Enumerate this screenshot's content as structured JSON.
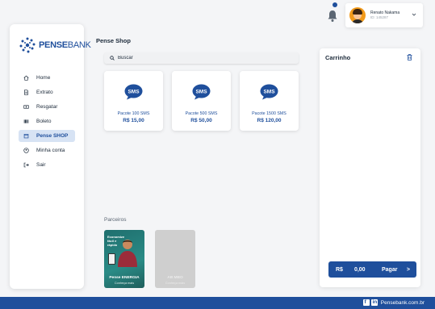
{
  "brand": {
    "name_bold": "PENSE",
    "name_rest": "BANK"
  },
  "sidebar": {
    "items": [
      {
        "label": "Home",
        "icon": "home-icon",
        "active": false
      },
      {
        "label": "Extrato",
        "icon": "document-icon",
        "active": false
      },
      {
        "label": "Resgatar",
        "icon": "cash-icon",
        "active": false
      },
      {
        "label": "Boleto",
        "icon": "barcode-icon",
        "active": false
      },
      {
        "label": "Pense SHOP",
        "icon": "calendar-icon",
        "active": true
      },
      {
        "label": "Minha conta",
        "icon": "user-icon",
        "active": false
      },
      {
        "label": "Sair",
        "icon": "logout-icon",
        "active": false
      }
    ]
  },
  "header": {
    "notification_icon": "bell-icon",
    "user_name": "Renato Nakama",
    "user_id": "ID: 145287"
  },
  "main": {
    "title": "Pense Shop",
    "search": {
      "placeholder": "Buscar",
      "value": ""
    },
    "products": [
      {
        "badge": "SMS",
        "name": "Pacote 100 SMS",
        "price": "R$ 15,00"
      },
      {
        "badge": "SMS",
        "name": "Pacote 500 SMS",
        "price": "R$ 50,00"
      },
      {
        "badge": "SMS",
        "name": "Pacote 1500 SMS",
        "price": "R$ 120,00"
      }
    ],
    "partners_title": "Parceiros",
    "partners": [
      {
        "headline": "Economize fácil e rápido",
        "title": "Pense ENERGIA",
        "subtitle": "Conheça mais"
      },
      {
        "headline": "",
        "title": "AB MBO",
        "subtitle": "Conheça mais"
      }
    ]
  },
  "cart": {
    "title": "Carrinho",
    "currency": "R$",
    "total": "0,00",
    "pay_label": "Pagar",
    "pay_arrow": ">"
  },
  "footer": {
    "site": "Pensebank.com.br"
  },
  "colors": {
    "primary": "#1f4f9c",
    "active_bg": "#d7e3f4",
    "background": "#f4f5f7"
  }
}
